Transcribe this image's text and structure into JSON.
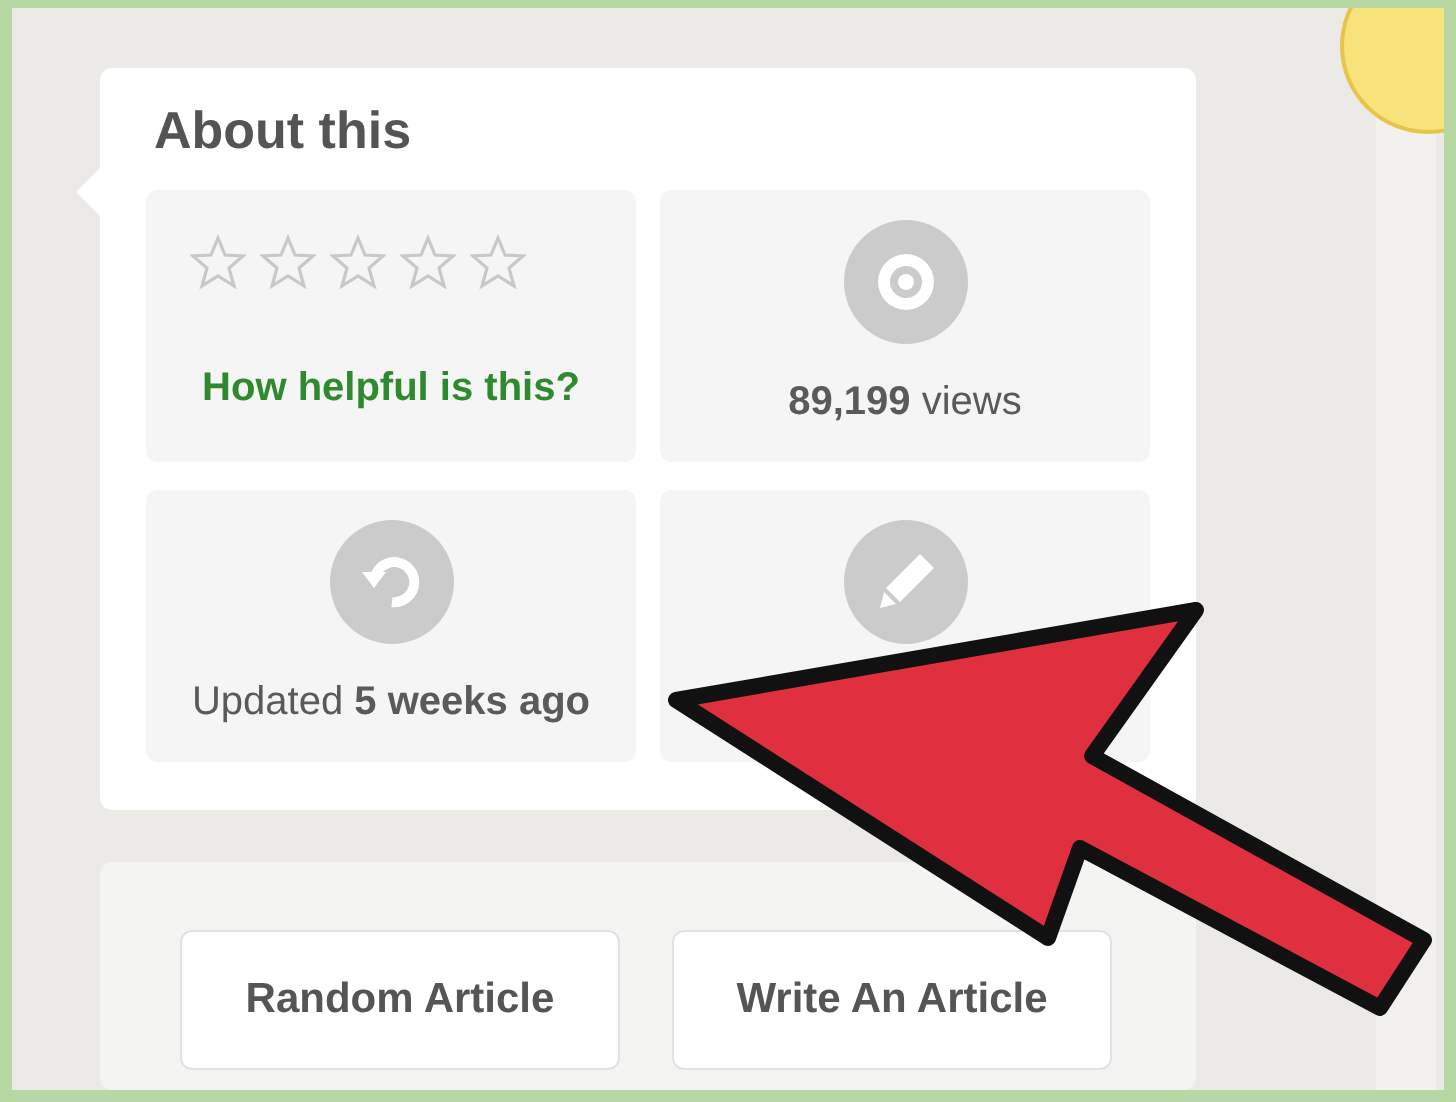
{
  "about": {
    "title": "About this",
    "tiles": [
      {
        "kind": "rating",
        "stars": 0,
        "prompt": "How helpful is this?"
      },
      {
        "kind": "views",
        "text": "**89,199** views"
      },
      {
        "kind": "updated",
        "text": "Updated **5 weeks ago**"
      },
      {
        "kind": "edit"
      }
    ]
  },
  "buttons": [
    "Random Article",
    "Write An Article"
  ]
}
